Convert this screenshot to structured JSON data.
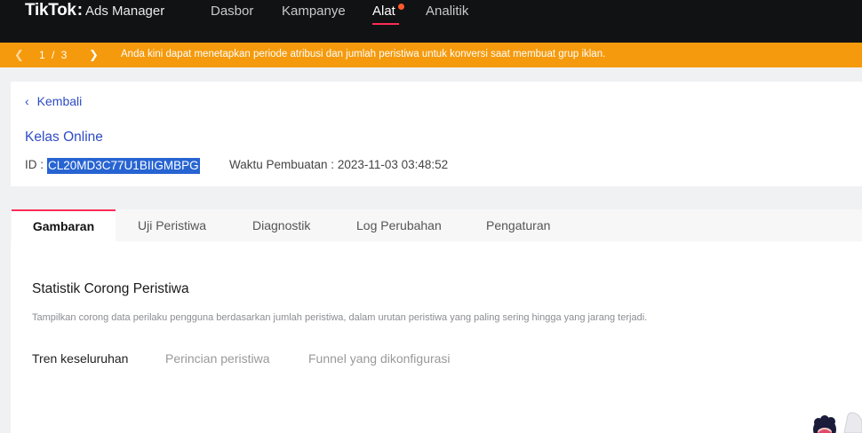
{
  "topnav": {
    "brand": "TikTok",
    "colon": ":",
    "product": "Ads Manager",
    "items": [
      {
        "label": "Dasbor"
      },
      {
        "label": "Kampanye"
      },
      {
        "label": "Alat"
      },
      {
        "label": "Analitik"
      }
    ],
    "active_index": 2,
    "accent_color": "#fe2c55"
  },
  "banner": {
    "page": "1 / 3",
    "message": "Anda kini dapat menetapkan periode atribusi dan jumlah peristiwa untuk konversi saat membuat grup iklan.",
    "color": "#f59a0c"
  },
  "detail": {
    "back_label": "Kembali",
    "name": "Kelas Online",
    "id_label": "ID :",
    "id_value": "CL20MD3C77U1BIIGMBPG",
    "created_label": "Waktu Pembuatan :",
    "created_value": "2023-11-03 03:48:52",
    "link_color": "#2f4cc5"
  },
  "tabs": [
    {
      "label": "Gambaran"
    },
    {
      "label": "Uji Peristiwa"
    },
    {
      "label": "Diagnostik"
    },
    {
      "label": "Log Perubahan"
    },
    {
      "label": "Pengaturan"
    }
  ],
  "content": {
    "title": "Statistik Corong Peristiwa",
    "description": "Tampilkan corong data perilaku pengguna berdasarkan jumlah peristiwa, dalam urutan peristiwa yang paling sering hingga yang jarang terjadi.",
    "subtabs": [
      {
        "label": "Tren keseluruhan"
      },
      {
        "label": "Perincian peristiwa"
      },
      {
        "label": "Funnel yang dikonfigurasi"
      }
    ]
  }
}
